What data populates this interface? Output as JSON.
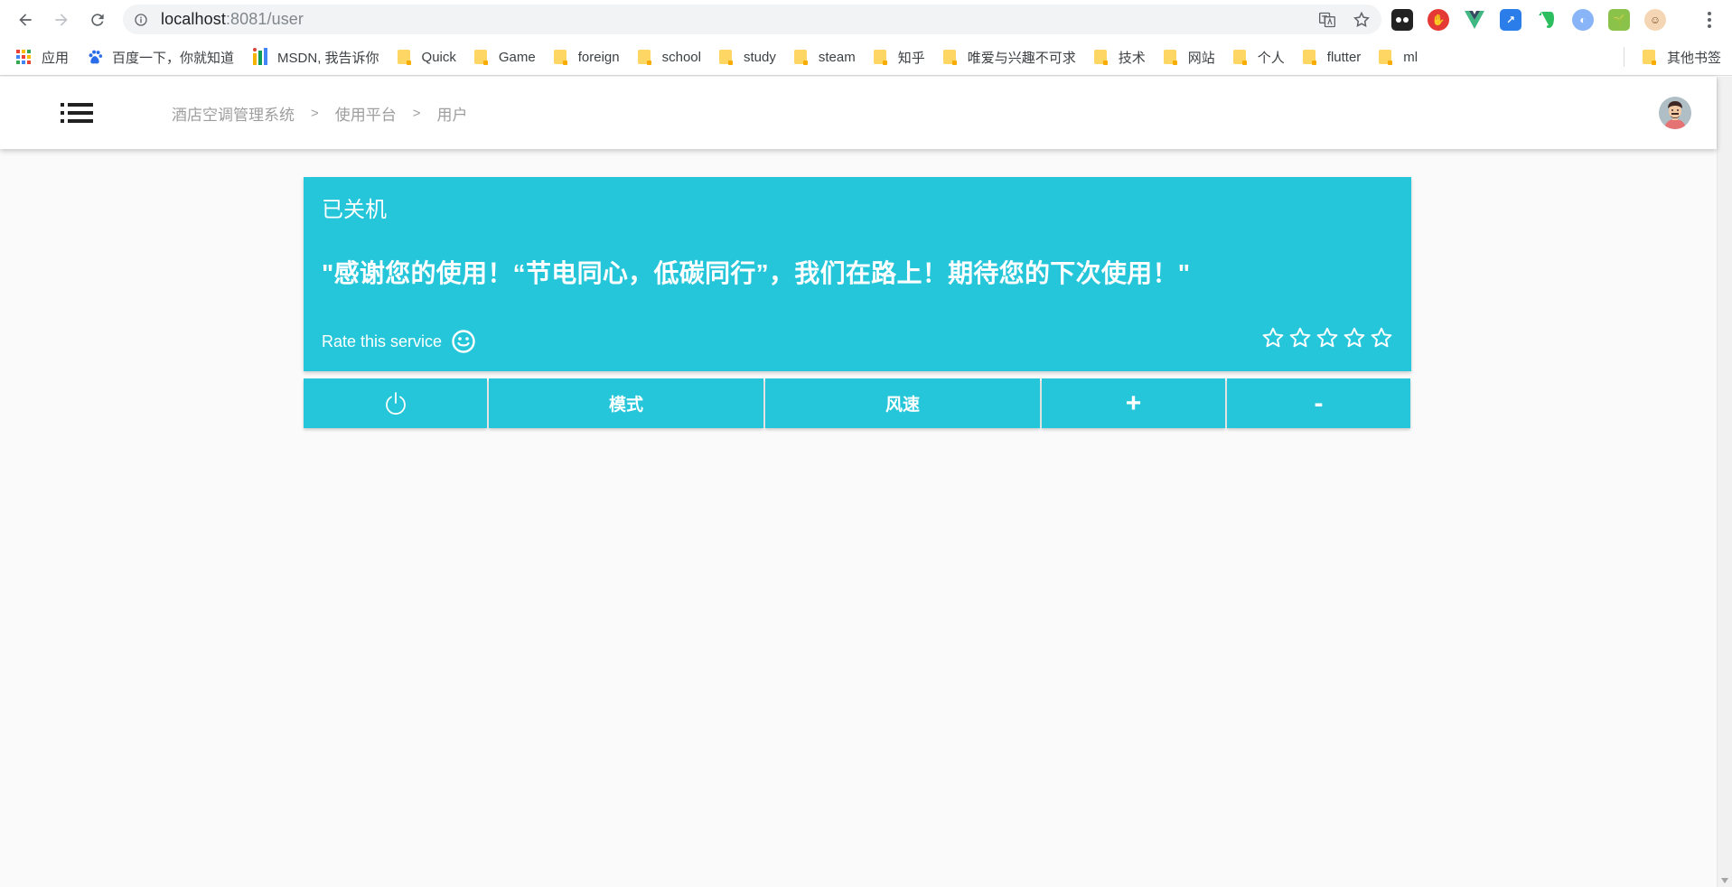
{
  "browser": {
    "url_host": "localhost",
    "url_path": ":8081/user",
    "bookmarks": [
      {
        "label": "应用",
        "type": "apps"
      },
      {
        "label": "百度一下，你就知道",
        "type": "paw"
      },
      {
        "label": "MSDN, 我告诉你",
        "type": "msdn"
      },
      {
        "label": "Quick",
        "type": "folder"
      },
      {
        "label": "Game",
        "type": "folder"
      },
      {
        "label": "foreign",
        "type": "folder"
      },
      {
        "label": "school",
        "type": "folder"
      },
      {
        "label": "study",
        "type": "folder"
      },
      {
        "label": "steam",
        "type": "folder"
      },
      {
        "label": "知乎",
        "type": "folder"
      },
      {
        "label": "唯爱与兴趣不可求",
        "type": "folder"
      },
      {
        "label": "技术",
        "type": "folder"
      },
      {
        "label": "网站",
        "type": "folder"
      },
      {
        "label": "个人",
        "type": "folder"
      },
      {
        "label": "flutter",
        "type": "folder"
      },
      {
        "label": "ml",
        "type": "folder"
      }
    ],
    "other_bookmarks": "其他书签"
  },
  "header": {
    "menu_icon": "list-icon",
    "breadcrumb": [
      "酒店空调管理系统",
      "使用平台",
      "用户"
    ],
    "breadcrumb_separator": ">",
    "avatar_icon": "user-avatar-icon"
  },
  "card": {
    "status": "已关机",
    "message": "\"感谢您的使用！“节电同心，低碳同行”，我们在路上！期待您的下次使用！\"",
    "rate_label": "Rate this service",
    "rating": 0,
    "rating_max": 5,
    "color": "#26c6da"
  },
  "controls": {
    "power_icon": "power-icon",
    "mode_label": "模式",
    "speed_label": "风速",
    "plus_label": "+",
    "minus_label": "-"
  }
}
